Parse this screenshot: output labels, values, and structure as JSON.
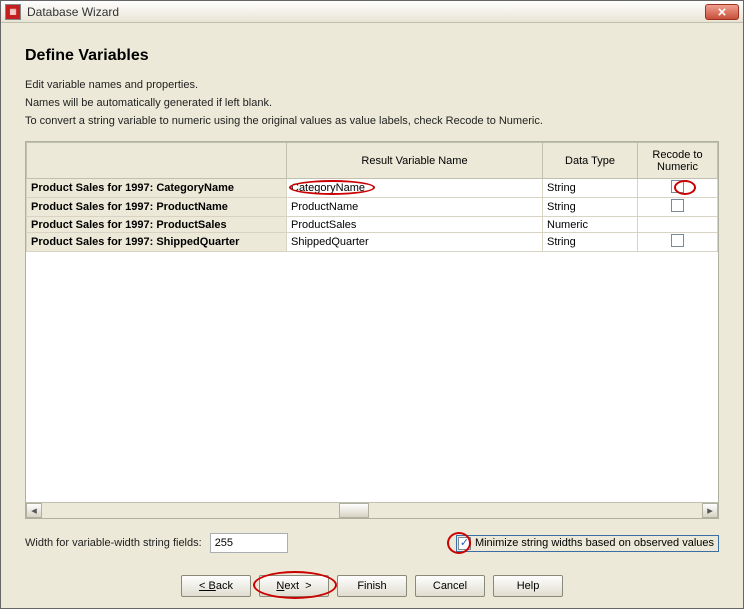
{
  "window": {
    "title": "Database Wizard"
  },
  "page": {
    "heading": "Define Variables",
    "instr1": "Edit variable names and properties.",
    "instr2": "Names will be automatically generated if left blank.",
    "instr3": "To convert a string variable to numeric using the original values as value labels, check Recode to Numeric."
  },
  "grid": {
    "headers": {
      "c1": "",
      "c2": "Result Variable Name",
      "c3": "Data Type",
      "c4": "Recode to Numeric"
    },
    "rows": [
      {
        "source": "Product Sales for 1997: CategoryName",
        "result": "CategoryName",
        "type": "String",
        "recode": false
      },
      {
        "source": "Product Sales for 1997: ProductName",
        "result": "ProductName",
        "type": "String",
        "recode": false
      },
      {
        "source": "Product Sales for 1997: ProductSales",
        "result": "ProductSales",
        "type": "Numeric",
        "recode": null
      },
      {
        "source": "Product Sales for 1997: ShippedQuarter",
        "result": "ShippedQuarter",
        "type": "String",
        "recode": false
      }
    ]
  },
  "width_field": {
    "label": "Width for variable-width string fields:",
    "value": "255"
  },
  "minimize_check": {
    "label": "Minimize string widths based on observed values",
    "checked": true
  },
  "buttons": {
    "back": "< Back",
    "next": "Next >",
    "finish": "Finish",
    "cancel": "Cancel",
    "help": "Help"
  }
}
